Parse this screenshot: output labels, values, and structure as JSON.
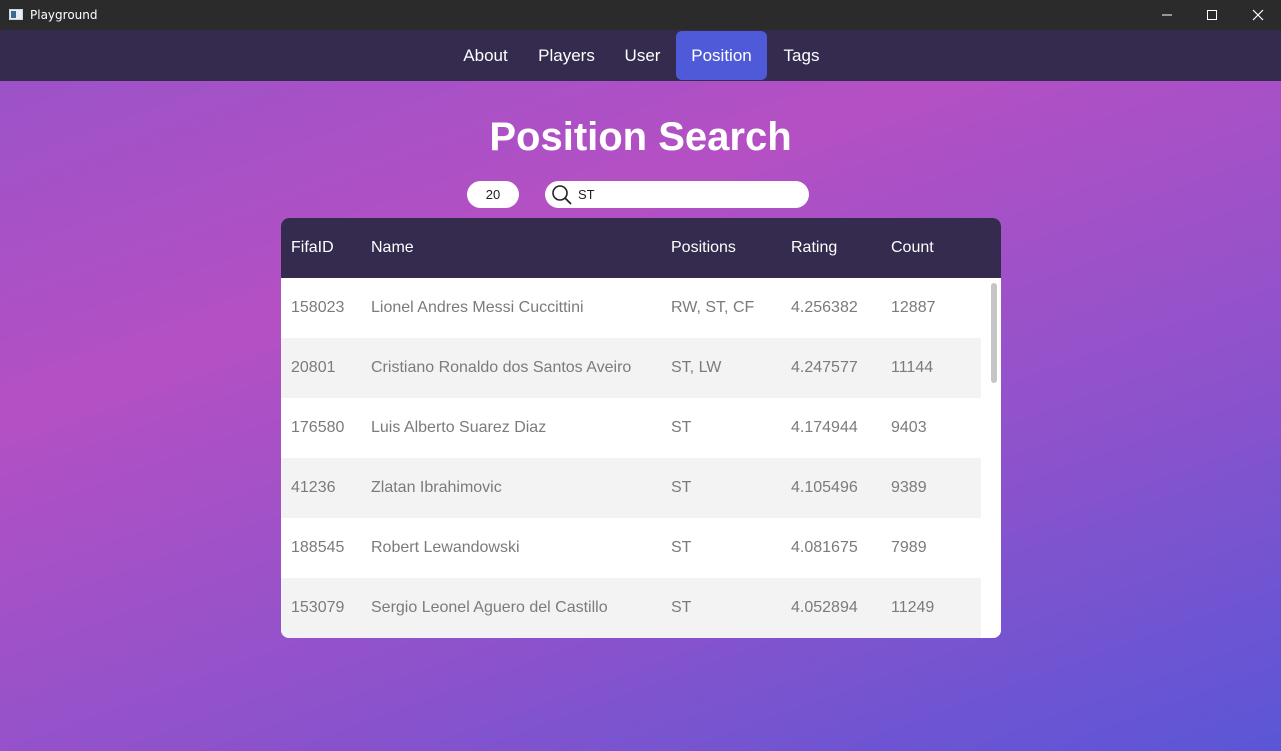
{
  "window": {
    "title": "Playground"
  },
  "nav": {
    "items": [
      "About",
      "Players",
      "User",
      "Position",
      "Tags"
    ],
    "active": "Position"
  },
  "page": {
    "title": "Position Search"
  },
  "controls": {
    "limit_value": "20",
    "search_value": "ST"
  },
  "table": {
    "columns": [
      "FifaID",
      "Name",
      "Positions",
      "Rating",
      "Count"
    ],
    "rows": [
      [
        "158023",
        "Lionel Andres Messi Cuccittini",
        "RW, ST, CF",
        "4.256382",
        "12887"
      ],
      [
        "20801",
        "Cristiano Ronaldo dos Santos Aveiro",
        "ST, LW",
        "4.247577",
        "11144"
      ],
      [
        "176580",
        "Luis Alberto Suarez Diaz",
        "ST",
        "4.174944",
        "9403"
      ],
      [
        "41236",
        "Zlatan Ibrahimovic",
        "ST",
        "4.105496",
        "9389"
      ],
      [
        "188545",
        "Robert Lewandowski",
        "ST",
        "4.081675",
        "7989"
      ],
      [
        "153079",
        "Sergio Leonel Aguero del Castillo",
        "ST",
        "4.052894",
        "11249"
      ]
    ]
  },
  "colors": {
    "nav_bg": "#342b4f",
    "active_tab": "#4e5ad7",
    "header_bg": "#342b4f",
    "gradient_start": "#9d52c8",
    "gradient_end": "#5a56d6"
  },
  "icons": {
    "search": "search-icon",
    "minimize": "minimize-icon",
    "maximize": "maximize-icon",
    "close": "close-icon"
  }
}
